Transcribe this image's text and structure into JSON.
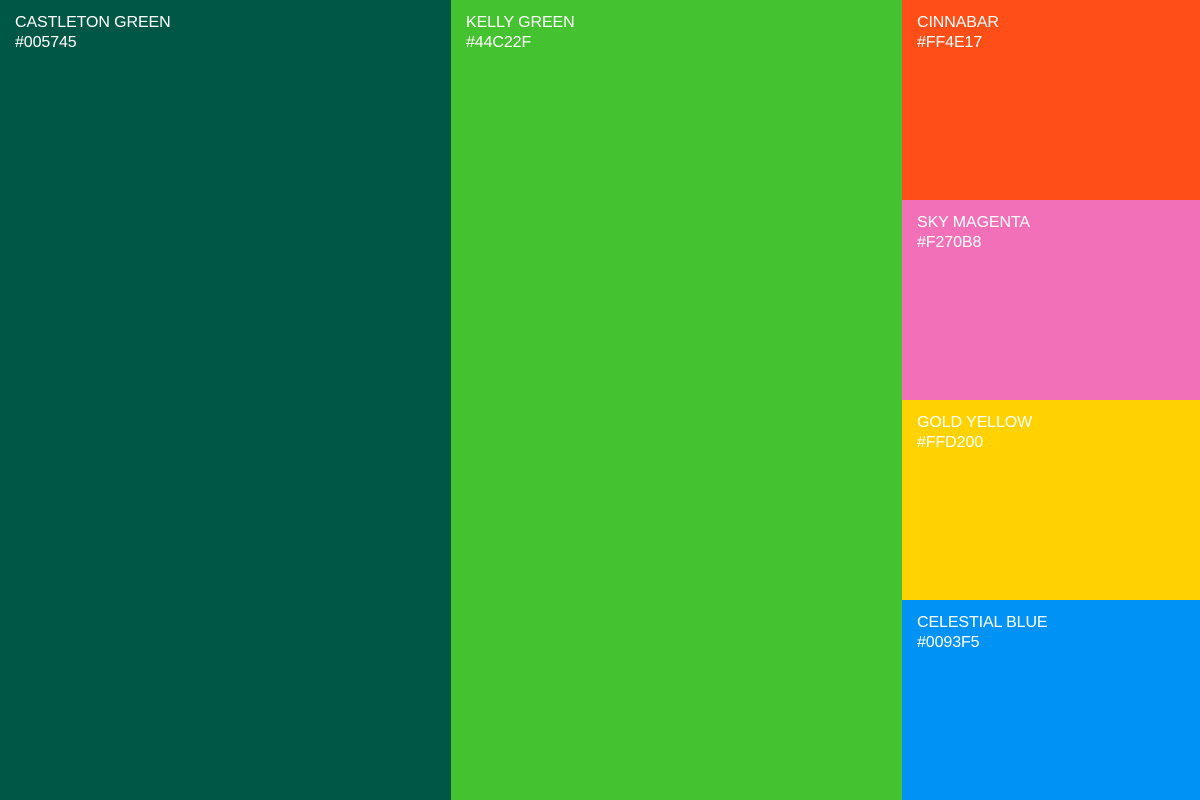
{
  "swatches": [
    {
      "name": "CASTLETON GREEN",
      "hex": "#005745",
      "color": "#005745"
    },
    {
      "name": "KELLY GREEN",
      "hex": "#44C22F",
      "color": "#44C22F"
    },
    {
      "name": "CINNABAR",
      "hex": "#FF4E17",
      "color": "#FF4E17"
    },
    {
      "name": "SKY MAGENTA",
      "hex": "#F270B8",
      "color": "#F270B8"
    },
    {
      "name": "GOLD YELLOW",
      "hex": "#FFD200",
      "color": "#FFD200"
    },
    {
      "name": "CELESTIAL BLUE",
      "hex": "#0093F5",
      "color": "#0093F5"
    }
  ]
}
